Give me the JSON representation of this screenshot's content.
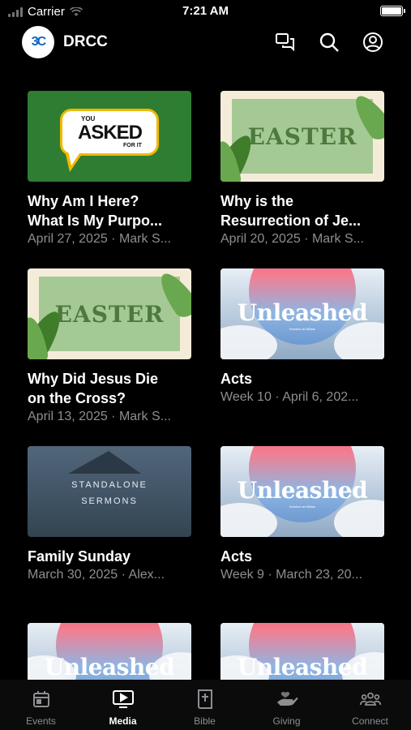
{
  "status_bar": {
    "carrier": "Carrier",
    "time": "7:21 AM"
  },
  "header": {
    "logo_text": "3C",
    "title": "DRCC"
  },
  "cards": [
    {
      "thumb": "you-asked-for-it",
      "title": "Why Am I Here?",
      "title2": "What Is My Purpo...",
      "subtitle": "April 27, 2025 · Mark S...",
      "art": {
        "you": "YOU",
        "asked": "ASKED",
        "forit": "FOR IT"
      }
    },
    {
      "thumb": "easter",
      "title": "Why is the",
      "title2": "Resurrection of Je...",
      "subtitle": "April 20, 2025 · Mark S...",
      "art": {
        "word": "EASTER"
      }
    },
    {
      "thumb": "easter",
      "title": "Why Did Jesus Die",
      "title2": "on the Cross?",
      "subtitle": "April 13, 2025 · Mark S...",
      "art": {
        "word": "EASTER"
      }
    },
    {
      "thumb": "unleashed",
      "title": "Acts",
      "subtitle": "Week 10 · April 6, 202...",
      "art": {
        "word": "Unleashed",
        "small": "freedom at Willow"
      }
    },
    {
      "thumb": "standalone-sermons",
      "title": "Family Sunday",
      "subtitle": "March 30, 2025 · Alex...",
      "art": {
        "line1": "STANDALONE",
        "line2": "SERMONS"
      }
    },
    {
      "thumb": "unleashed",
      "title": "Acts",
      "subtitle": "Week 9 · March 23, 20...",
      "art": {
        "word": "Unleashed",
        "small": "freedom at Willow"
      }
    },
    {
      "thumb": "unleashed",
      "art": {
        "word": "Unleashed"
      }
    },
    {
      "thumb": "unleashed",
      "art": {
        "word": "Unleashed"
      }
    }
  ],
  "tabs": [
    {
      "label": "Events",
      "icon": "calendar-icon",
      "active": false
    },
    {
      "label": "Media",
      "icon": "media-play-icon",
      "active": true
    },
    {
      "label": "Bible",
      "icon": "bible-icon",
      "active": false
    },
    {
      "label": "Giving",
      "icon": "giving-hand-icon",
      "active": false
    },
    {
      "label": "Connect",
      "icon": "people-icon",
      "active": false
    }
  ],
  "colors": {
    "background": "#000000",
    "muted_text": "#8e8e93",
    "active_tab": "#ffffff",
    "inactive_tab": "#8e8e93"
  }
}
